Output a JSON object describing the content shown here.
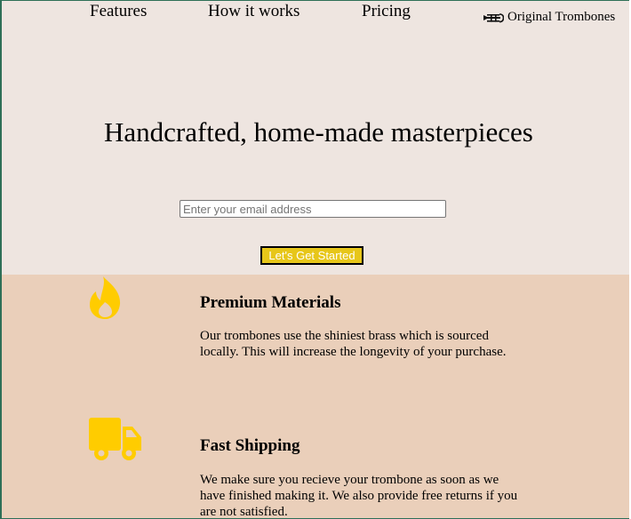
{
  "nav": {
    "links": [
      "Features",
      "How it works",
      "Pricing"
    ],
    "brand_label": "Original Trombones"
  },
  "hero": {
    "title": "Handcrafted, home-made masterpieces",
    "email_placeholder": "Enter your email address",
    "email_value": "",
    "cta_label": "Let's Get Started"
  },
  "features": [
    {
      "icon": "fire-icon",
      "title": "Premium Materials",
      "description": "Our trombones use the shiniest brass which is sourced locally. This will increase the longevity of your purchase."
    },
    {
      "icon": "truck-icon",
      "title": "Fast Shipping",
      "description": "We make sure you recieve your trombone as soon as we have finished making it. We also provide free returns if you are not satisfied."
    }
  ],
  "colors": {
    "hero_background": "#eee5e0",
    "features_background": "#eacfba",
    "accent_yellow": "#ffcc00",
    "button_yellow": "#e7c619",
    "frame_border": "#2e6f57"
  }
}
